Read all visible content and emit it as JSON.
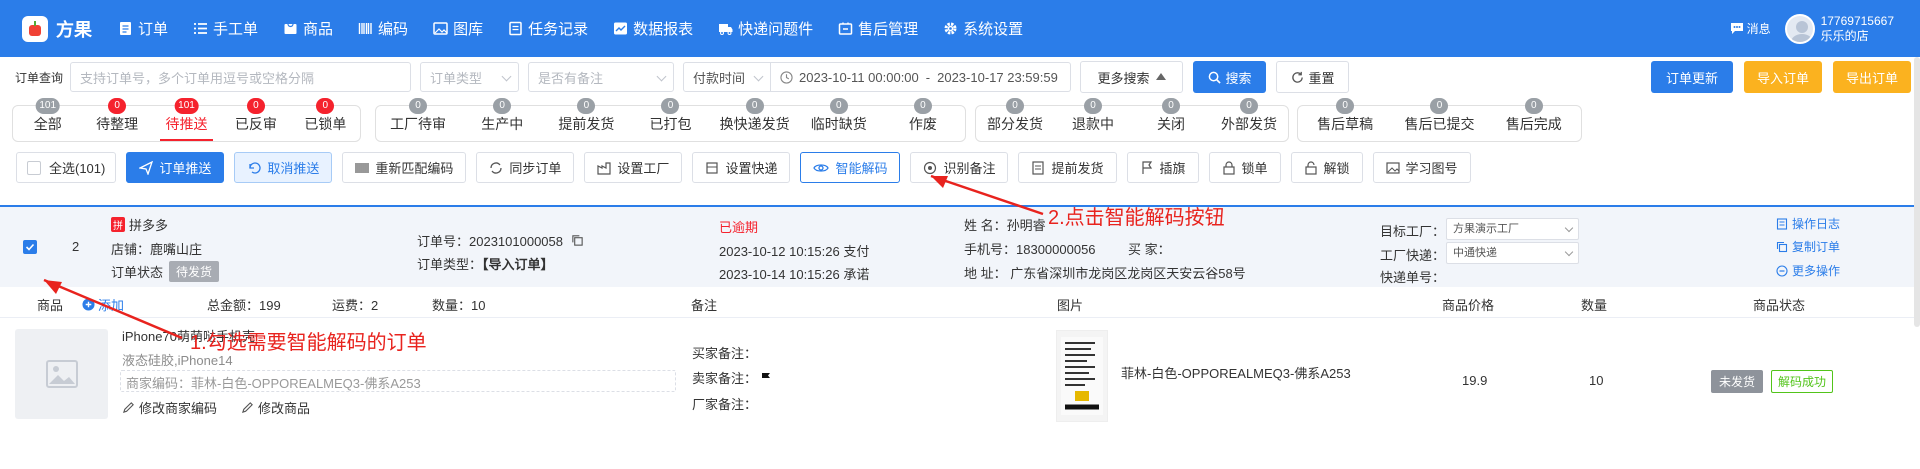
{
  "app": {
    "name": "方果"
  },
  "nav": {
    "items": [
      {
        "label": "订单",
        "icon": "order-icon"
      },
      {
        "label": "手工单",
        "icon": "list-icon"
      },
      {
        "label": "商品",
        "icon": "goods-icon"
      },
      {
        "label": "编码",
        "icon": "barcode-icon"
      },
      {
        "label": "图库",
        "icon": "image-icon"
      },
      {
        "label": "任务记录",
        "icon": "task-icon"
      },
      {
        "label": "数据报表",
        "icon": "chart-icon"
      },
      {
        "label": "快递问题件",
        "icon": "parcel-icon"
      },
      {
        "label": "售后管理",
        "icon": "aftersale-icon"
      },
      {
        "label": "系统设置",
        "icon": "gear-icon"
      }
    ]
  },
  "user": {
    "msg_label": "消息",
    "phone": "17769715667",
    "shop": "乐乐的店"
  },
  "search": {
    "label": "订单查询",
    "placeholder": "支持订单号，多个订单用逗号或空格分隔",
    "order_type": "订单类型",
    "remark": "是否有备注",
    "time_type": "付款时间",
    "date_start": "2023-10-11 00:00:00",
    "date_sep": "-",
    "date_end": "2023-10-17 23:59:59",
    "more": "更多搜索",
    "search_btn": "搜索",
    "reset_btn": "重置",
    "update_btn": "订单更新",
    "import_btn": "导入订单",
    "export_btn": "导出订单"
  },
  "tab_groups": [
    [
      {
        "label": "全部",
        "count": "101",
        "color": "gray"
      },
      {
        "label": "待整理",
        "count": "0",
        "color": "red"
      },
      {
        "label": "待推送",
        "count": "101",
        "color": "red",
        "active": true
      },
      {
        "label": "已反审",
        "count": "0",
        "color": "red"
      },
      {
        "label": "已锁单",
        "count": "0",
        "color": "red"
      }
    ],
    [
      {
        "label": "工厂待审",
        "count": "0",
        "color": "gray"
      },
      {
        "label": "生产中",
        "count": "0",
        "color": "gray"
      },
      {
        "label": "提前发货",
        "count": "0",
        "color": "gray"
      },
      {
        "label": "已打包",
        "count": "0",
        "color": "gray"
      },
      {
        "label": "换快递发货",
        "count": "0",
        "color": "gray"
      },
      {
        "label": "临时缺货",
        "count": "0",
        "color": "gray"
      },
      {
        "label": "作废",
        "count": "0",
        "color": "gray"
      }
    ],
    [
      {
        "label": "部分发货",
        "count": "0",
        "color": "gray"
      },
      {
        "label": "退款中",
        "count": "0",
        "color": "gray"
      },
      {
        "label": "关闭",
        "count": "0",
        "color": "gray"
      },
      {
        "label": "外部发货",
        "count": "0",
        "color": "gray"
      }
    ],
    [
      {
        "label": "售后草稿",
        "count": "0",
        "color": "gray"
      },
      {
        "label": "售后已提交",
        "count": "0",
        "color": "gray"
      },
      {
        "label": "售后完成",
        "count": "0",
        "color": "gray"
      }
    ]
  ],
  "actions": {
    "select_all": "全选(101)",
    "push": "订单推送",
    "cancel_push": "取消推送",
    "rematch": "重新匹配编码",
    "sync": "同步订单",
    "set_factory": "设置工厂",
    "set_express": "设置快递",
    "smart_decode": "智能解码",
    "recognize_remark": "识别备注",
    "early_ship": "提前发货",
    "flag": "插旗",
    "lock": "锁单",
    "unlock": "解锁",
    "learn_image": "学习图号"
  },
  "annotations": {
    "step1": "1.勾选需要智能解码的订单",
    "step2": "2.点击智能解码按钮"
  },
  "order": {
    "index": "2",
    "platform_badge": "拼",
    "platform": "拼多多",
    "shop": "店铺：鹿嘴山庄",
    "status_label": "订单状态",
    "status": "待发货",
    "order_no": "订单号：2023101000058",
    "order_type": "订单类型：",
    "order_type_value": "【导入订单】",
    "overdue": "已逾期",
    "pay_time": "2023-10-12 10:15:26 支付",
    "promise_time": "2023-10-14 10:15:26 承诺",
    "name": "姓 名：孙明睿",
    "phone": "手机号：18300000056",
    "buyer": "买 家：",
    "address": "地 址： 广东省深圳市龙岗区龙岗区天安云谷58号",
    "target_factory_label": "目标工厂：",
    "target_factory": "方果演示工厂",
    "factory_express_label": "工厂快递：",
    "factory_express": "中通快递",
    "tracking_label": "快递单号：",
    "op_log": "操作日志",
    "copy_order": "复制订单",
    "more_ops": "更多操作"
  },
  "columns": {
    "product": "商品",
    "add": "添加",
    "total": "总金额：199",
    "shipping": "运费：2",
    "qty": "数量：10",
    "remark": "备注",
    "image": "图片",
    "price": "商品价格",
    "quantity": "数量",
    "state": "商品状态"
  },
  "product": {
    "name": "iPhone70萌萌哒手机壳",
    "spec": "液态硅胶,iPhone14",
    "merchant_code": "商家编码：菲林-白色-OPPOREALMEQ3-佛系A253",
    "edit_code": "修改商家编码",
    "edit_product": "修改商品",
    "buyer_remark": "买家备注：",
    "seller_remark": "卖家备注：",
    "factory_remark": "厂家备注：",
    "image_code": "菲林-白色-OPPOREALMEQ3-佛系A253",
    "price": "19.9",
    "quantity": "10",
    "ship_status": "未发货",
    "decode_status": "解码成功"
  }
}
